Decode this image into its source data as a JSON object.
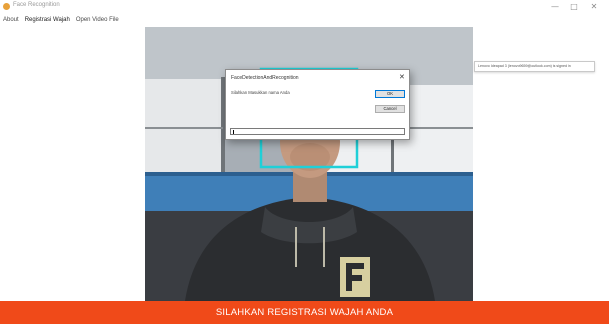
{
  "window": {
    "title": "Face Recognition",
    "controls": {
      "minimize": "—",
      "maximize": "□",
      "close": "✕"
    }
  },
  "menu": {
    "items": [
      "About",
      "Registrasi Wajah",
      "Open Video File"
    ],
    "active_index": 1
  },
  "toast": {
    "text": "Lenovo Ideapad 3 (lenovo9659@outlook.com) is signed in"
  },
  "dialog": {
    "title": "FaceDetectionAndRecognition",
    "prompt": "Silahkan Masukkan nama Anda",
    "ok_label": "OK",
    "cancel_label": "Cancel",
    "input_value": ""
  },
  "banner": {
    "text": "SILAHKAN REGISTRASI WAJAH ANDA"
  },
  "colors": {
    "banner": "#f04a19",
    "face_box": "#1fd0d8",
    "app_icon": "#e8a13a"
  },
  "icons": {
    "app": "face-recognition-app-icon"
  }
}
